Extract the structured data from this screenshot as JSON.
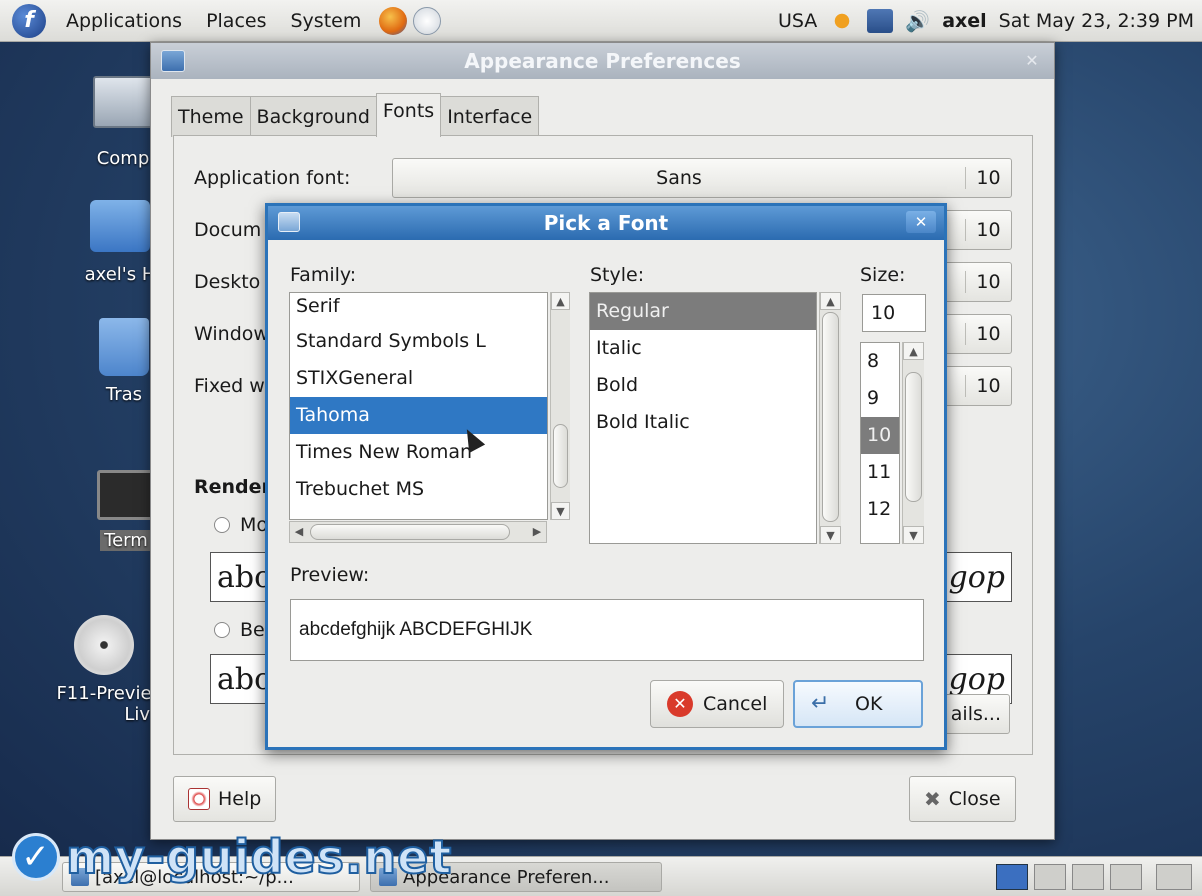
{
  "top_panel": {
    "menus": [
      "Applications",
      "Places",
      "System"
    ],
    "keyboard": "USA",
    "user": "axel",
    "clock": "Sat May 23,  2:39 PM"
  },
  "desktop": {
    "icons": [
      {
        "label": "Comp"
      },
      {
        "label": "axel's H"
      },
      {
        "label": "Tras"
      },
      {
        "label": "Term"
      },
      {
        "label": "F11-Previe",
        "label2": "Liv"
      }
    ]
  },
  "appearance": {
    "title": "Appearance Preferences",
    "tabs": [
      "Theme",
      "Background",
      "Fonts",
      "Interface"
    ],
    "active_tab": "Fonts",
    "rows": [
      {
        "label": "Application font:",
        "font": "Sans",
        "size": "10"
      },
      {
        "label": "Docum",
        "font": "",
        "size": "10"
      },
      {
        "label": "Deskto",
        "font": "",
        "size": "10"
      },
      {
        "label": "Window",
        "font": "",
        "size": "10"
      },
      {
        "label": "Fixed w",
        "font": "",
        "size": "10"
      }
    ],
    "rendering_title": "Render",
    "radio1": "Mo",
    "radio2": "Be",
    "sample_left": "abc",
    "sample_right": "gop",
    "details_label": "ails...",
    "help_label": "Help",
    "close_label": "Close"
  },
  "font_dialog": {
    "title": "Pick a Font",
    "family_label": "Family:",
    "style_label": "Style:",
    "size_label": "Size:",
    "families": [
      "Serif",
      "Standard Symbols L",
      "STIXGeneral",
      "Tahoma",
      "Times New Roman",
      "Trebuchet MS"
    ],
    "selected_family": "Tahoma",
    "styles": [
      "Regular",
      "Italic",
      "Bold",
      "Bold Italic"
    ],
    "selected_style": "Regular",
    "size_value": "10",
    "sizes": [
      "8",
      "9",
      "10",
      "11",
      "12"
    ],
    "selected_size": "10",
    "preview_label": "Preview:",
    "preview_text": "abcdefghijk ABCDEFGHIJK",
    "cancel_label": "Cancel",
    "ok_label": "OK"
  },
  "taskbar": {
    "tasks": [
      {
        "label": "[axel@localhost:~/p..."
      },
      {
        "label": "Appearance Preferen..."
      }
    ]
  },
  "watermark": "my-guides.net",
  "colors": {
    "selection_blue": "#2f78c4",
    "dialog_border": "#2b73b9",
    "desktop_blue": "#26446a"
  }
}
